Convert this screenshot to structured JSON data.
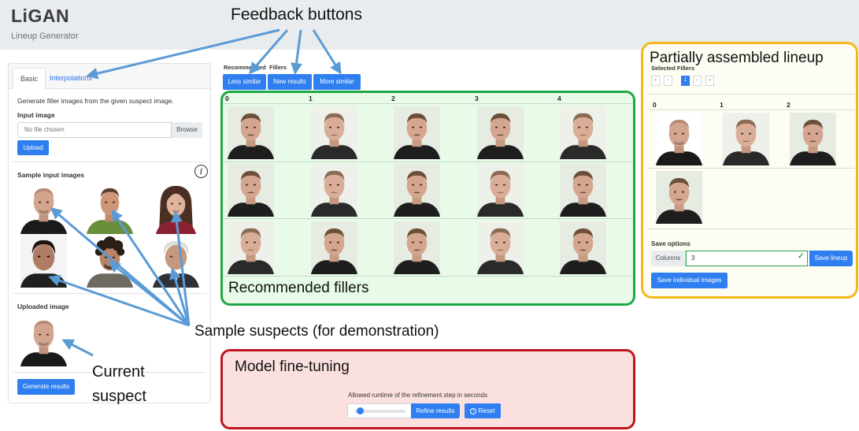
{
  "header": {
    "title": "LiGAN",
    "subtitle": "Lineup Generator"
  },
  "left_panel": {
    "tabs": [
      {
        "label": "Basic"
      },
      {
        "label": "Interpolations"
      }
    ],
    "description": "Generate filler images from the given suspect image.",
    "input_label": "Input image",
    "file_placeholder": "No file chosen",
    "browse_label": "Browse",
    "upload_label": "Upload",
    "samples_label": "Sample input images",
    "uploaded_label": "Uploaded image",
    "generate_label": "Generate results"
  },
  "fillers": {
    "label_left": "Recommended",
    "label_right": "Fillers",
    "buttons": {
      "less": "Less similar",
      "new": "New results",
      "more": "More similar"
    },
    "columns": [
      "0",
      "1",
      "2",
      "3",
      "4"
    ]
  },
  "lineup": {
    "label": "Selected Fillers",
    "pagination": {
      "first": "«",
      "prev": "‹",
      "page": "1",
      "next": "›",
      "last": "»"
    },
    "columns": [
      "0",
      "1",
      "2"
    ],
    "save_options_label": "Save options",
    "columns_label": "Columns",
    "columns_value": "3",
    "save_lineup_label": "Save lineup",
    "save_individual_label": "Save individual images"
  },
  "refine": {
    "text": "Allowed runtime of the refinement step in seconds",
    "refine_label": "Refine results",
    "reset_label": "Reset",
    "slider_value": 0.05
  },
  "annotations": {
    "feedback": "Feedback buttons",
    "partial": "Partially assembled lineup",
    "recommended": "Recommended fillers",
    "samples": "Sample suspects (for demonstration)",
    "current_line1": "Current",
    "current_line2": "suspect",
    "model": "Model fine-tuning"
  },
  "colors": {
    "primary": "#2f7ff0",
    "green_box": "#1fa845",
    "yellow_box": "#f5b81c",
    "red_box": "#c0161b",
    "arrow": "#5b9bd5"
  }
}
